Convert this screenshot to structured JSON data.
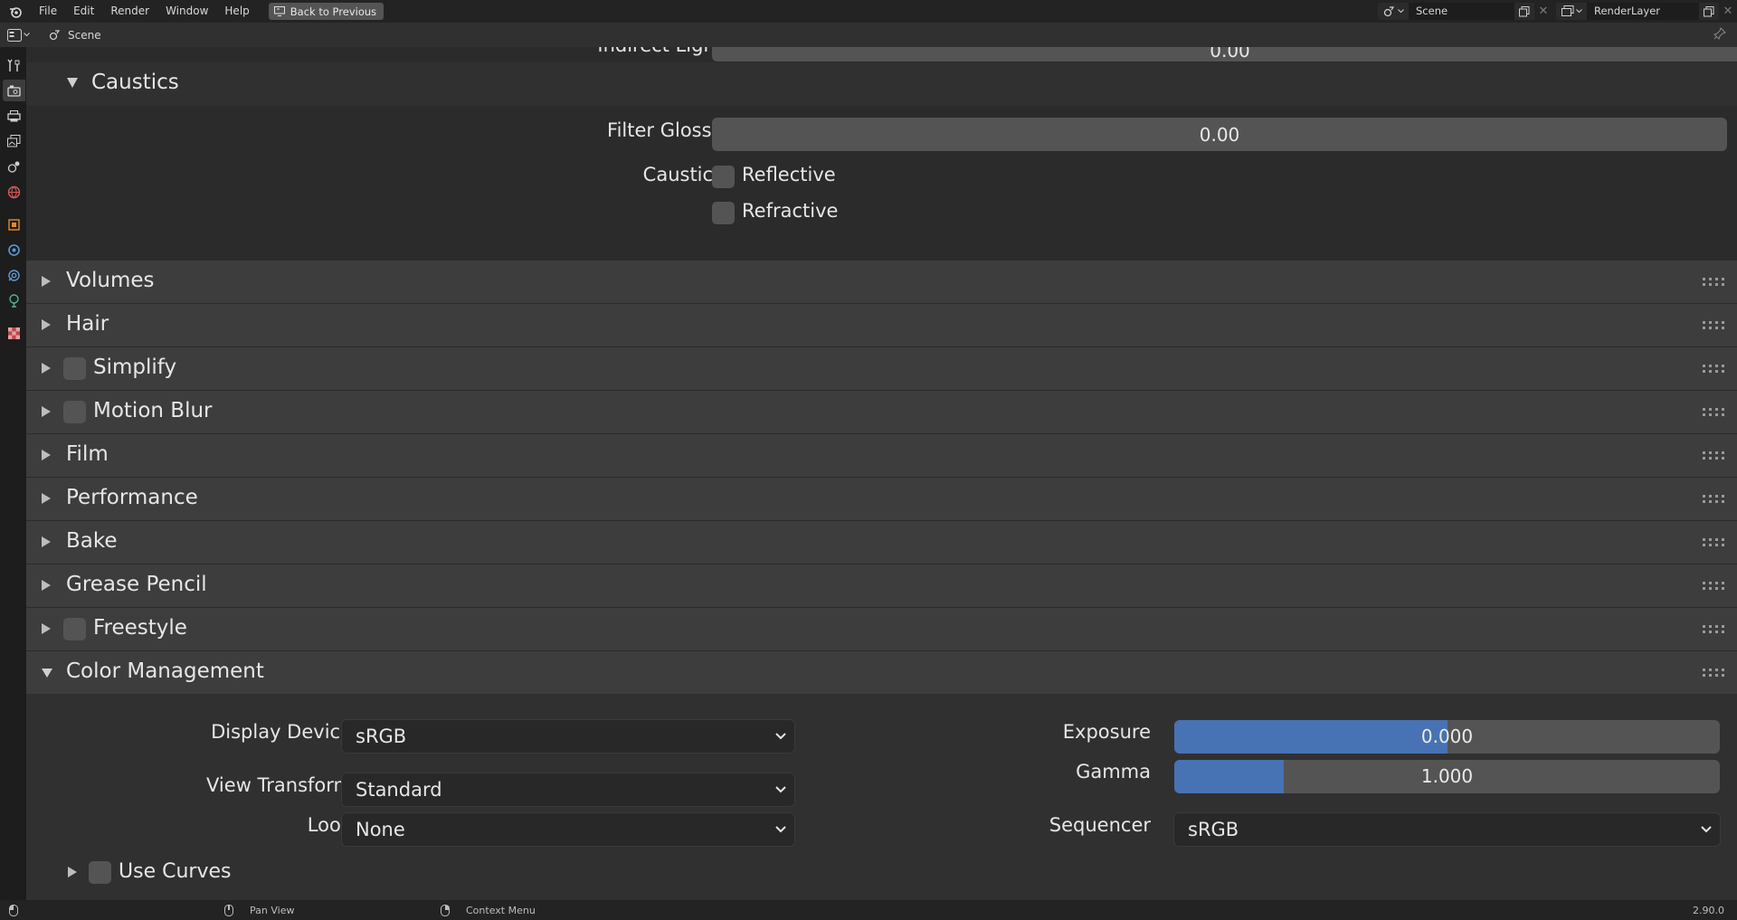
{
  "menubar": {
    "items": [
      "File",
      "Edit",
      "Render",
      "Window",
      "Help"
    ],
    "back_button": "Back to Previous",
    "scene_field": "Scene",
    "view_layer_field": "RenderLayer"
  },
  "editor_header": {
    "breadcrumb": "Scene"
  },
  "top_partial": {
    "label": "Indirect Light",
    "value": "0.00"
  },
  "caustics_panel": {
    "title": "Caustics",
    "filter_glossy_label": "Filter Glossy",
    "filter_glossy_value": "0.00",
    "caustics_label": "Caustics",
    "reflective_label": "Reflective",
    "refractive_label": "Refractive"
  },
  "panels": {
    "volumes": "Volumes",
    "hair": "Hair",
    "simplify": "Simplify",
    "motion_blur": "Motion Blur",
    "film": "Film",
    "performance": "Performance",
    "bake": "Bake",
    "grease_pencil": "Grease Pencil",
    "freestyle": "Freestyle",
    "color_management": "Color Management"
  },
  "color_management": {
    "display_device_label": "Display Device",
    "display_device_value": "sRGB",
    "view_transform_label": "View Transform",
    "view_transform_value": "Standard",
    "look_label": "Look",
    "look_value": "None",
    "exposure_label": "Exposure",
    "exposure_value": "0.000",
    "exposure_fill_fraction": 0.5,
    "gamma_label": "Gamma",
    "gamma_value": "1.000",
    "gamma_fill_fraction": 0.2,
    "sequencer_label": "Sequencer",
    "sequencer_value": "sRGB",
    "use_curves_label": "Use Curves"
  },
  "statusbar": {
    "pan_view": "Pan View",
    "context_menu": "Context Menu",
    "version": "2.90.0"
  },
  "colors": {
    "accent": "#4772b3",
    "field": "#545454",
    "panel_header": "#3d3d3d",
    "background": "#303030"
  }
}
